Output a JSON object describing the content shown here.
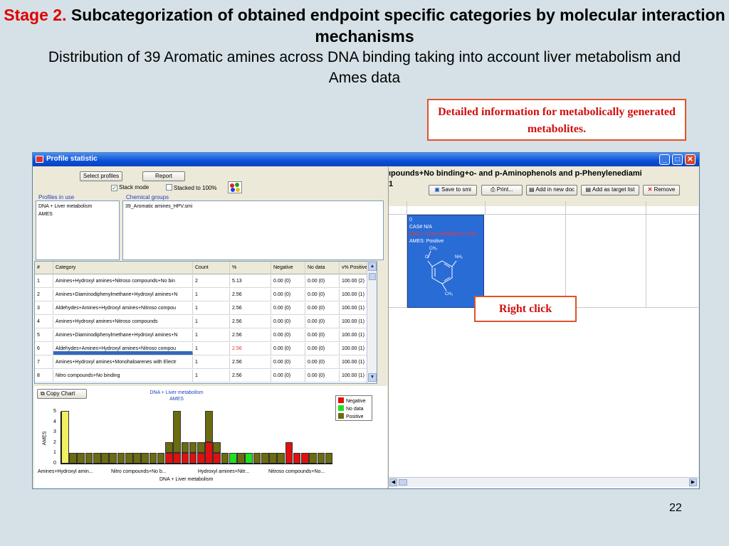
{
  "slide": {
    "stage": "Stage 2.",
    "title_rest": "Subcategorization of obtained endpoint specific categories  by molecular interaction mechanisms",
    "subtitle": "Distribution of 39 Aromatic amines across DNA binding taking into account liver metabolism and Ames data",
    "callout_top": "Detailed information for metabolically generated metabolites.",
    "callout_right": "Right click",
    "page_number": "22"
  },
  "window": {
    "title": "Profile statistic",
    "buttons": {
      "min": "_",
      "max": "□",
      "close": "✕"
    }
  },
  "toolbar": {
    "select_profiles": "Select profiles",
    "report": "Report",
    "stack_mode": "Stack mode",
    "stacked_100": "Stacked to 100%",
    "stack_mode_checked": "✓"
  },
  "profiles": {
    "label": "Profiles in use",
    "items": [
      "DNA + Liver metabolism",
      "AMES"
    ]
  },
  "chemical_groups": {
    "label": "Chemical groups",
    "items": [
      "39_Aromatic amines_HPV.smi"
    ]
  },
  "table": {
    "headers": [
      "#",
      "Category",
      "Count",
      "%",
      "Negative",
      "No data",
      "v% Positive"
    ],
    "rows": [
      [
        "1",
        "Amines+Hydroxyl amines+Nitroso compounds+No bin",
        "2",
        "5.13",
        "0.00 (0)",
        "0.00 (0)",
        "100.00 (2)"
      ],
      [
        "2",
        "Amines+Diaminodiphenylmethane+Hydroxyl amines+N",
        "1",
        "2.56",
        "0.00 (0)",
        "0.00 (0)",
        "100.00 (1)"
      ],
      [
        "3",
        "Aldehydes+Amines+Hydroxyl amines+Nitroso compou",
        "1",
        "2.56",
        "0.00 (0)",
        "0.00 (0)",
        "100.00 (1)"
      ],
      [
        "4",
        "Amines+Hydroxyl amines+Nitroso compounds",
        "1",
        "2.56",
        "0.00 (0)",
        "0.00 (0)",
        "100.00 (1)"
      ],
      [
        "5",
        "Amines+Diaminodiphenylmethane+Hydroxyl amines+N",
        "1",
        "2.56",
        "0.00 (0)",
        "0.00 (0)",
        "100.00 (1)"
      ],
      [
        "6",
        "Aldehydes+Amines+Hydroxyl amines+Nitroso compou",
        "1",
        "2.56",
        "0.00 (0)",
        "0.00 (0)",
        "100.00 (1)"
      ],
      [
        "7",
        "Amines+Hydroxyl amines+Monohaloarenes with Electr",
        "1",
        "2.56",
        "0.00 (0)",
        "0.00 (0)",
        "100.00 (1)"
      ],
      [
        "8",
        "Nitro compounds+No binding",
        "1",
        "2.56",
        "0.00 (0)",
        "0.00 (0)",
        "100.00 (1)"
      ]
    ],
    "selected_row": 5,
    "highlight_color": "#e03030"
  },
  "chart": {
    "copy_button": "Copy Chart",
    "title_line1": "DNA + Liver metabolism",
    "title_line2": "AMES",
    "ylabel": "AMES",
    "xlabel": "DNA + Liver metabolism",
    "yticks": [
      "5",
      "4",
      "3",
      "2",
      "1",
      "0"
    ],
    "xticks": [
      "Amines+Hydroxyl amin...",
      "Nitro compounds+No b...",
      "Hydroxyl amines+Nitr...",
      "Nitroso compounds+No..."
    ],
    "legend": [
      {
        "name": "Negative",
        "color": "#e01010"
      },
      {
        "name": "No data",
        "color": "#20e020"
      },
      {
        "name": "Positive",
        "color": "#6b6b10"
      }
    ]
  },
  "chart_data": {
    "type": "bar",
    "stacked": true,
    "ylim": [
      0,
      5
    ],
    "categories_count": 34,
    "series": [
      {
        "name": "Negative",
        "values": [
          0,
          0,
          0,
          0,
          0,
          0,
          0,
          0,
          0,
          0,
          0,
          0,
          0,
          1,
          1,
          1,
          1,
          1,
          2,
          1,
          0,
          0,
          0,
          0,
          0,
          0,
          0,
          0,
          2,
          1,
          1,
          0,
          0,
          0
        ]
      },
      {
        "name": "No data",
        "values": [
          0,
          0,
          0,
          0,
          0,
          0,
          0,
          0,
          0,
          0,
          0,
          0,
          0,
          0,
          0,
          0,
          0,
          0,
          0,
          0,
          0,
          1,
          0,
          1,
          0,
          0,
          0,
          0,
          0,
          0,
          0,
          0,
          0,
          0
        ]
      },
      {
        "name": "Positive",
        "values": [
          5,
          1,
          1,
          1,
          1,
          1,
          1,
          1,
          1,
          1,
          1,
          1,
          1,
          1,
          4,
          1,
          1,
          1,
          3,
          1,
          1,
          0,
          1,
          0,
          1,
          1,
          1,
          1,
          0,
          0,
          0,
          1,
          1,
          1
        ]
      }
    ]
  },
  "right_pane": {
    "title_line1": "ıpounds+No binding+o- and p-Aminophenols and p-Phenylenediami",
    "title_line2": "1",
    "buttons": [
      "Save to smi",
      "Print...",
      "Add in new doc",
      "Add as target list",
      "Remove"
    ],
    "card": {
      "line1": "0",
      "cas": "CAS# N/A",
      "profile": "DNA + Liver metabolism: Amin",
      "ames": "AMES: Positive",
      "atom_ch3_top": "CH₃",
      "atom_o": "O",
      "atom_nh2": "NH₂",
      "atom_ch3_bottom": "CH₃"
    }
  }
}
